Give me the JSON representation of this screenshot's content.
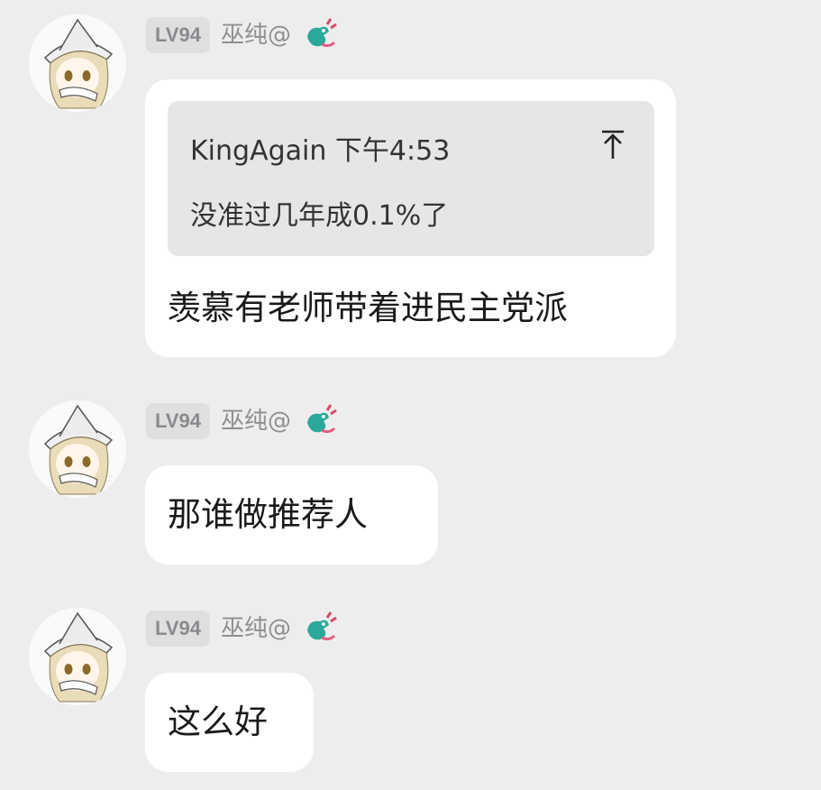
{
  "messages": [
    {
      "level": "LV94",
      "nickname": "巫纯@",
      "avatar_icon": "anime-girl-witch-hat-avatar",
      "badge_icon": "dragon-icon",
      "quote": {
        "author": "KingAgain",
        "time": "下午4:53",
        "text": "没准过几年成0.1%了",
        "jump_icon": "arrow-up-to-top-icon"
      },
      "text": "羡慕有老师带着进民主党派"
    },
    {
      "level": "LV94",
      "nickname": "巫纯@",
      "avatar_icon": "anime-girl-witch-hat-avatar",
      "badge_icon": "dragon-icon",
      "text": "那谁做推荐人"
    },
    {
      "level": "LV94",
      "nickname": "巫纯@",
      "avatar_icon": "anime-girl-witch-hat-avatar",
      "badge_icon": "dragon-icon",
      "text": "这么好"
    }
  ],
  "colors": {
    "background": "#ededed",
    "bubble": "#ffffff",
    "quote_background": "#e6e6e6",
    "level_badge": "#e0dfe0",
    "nickname": "#8f8f93"
  }
}
